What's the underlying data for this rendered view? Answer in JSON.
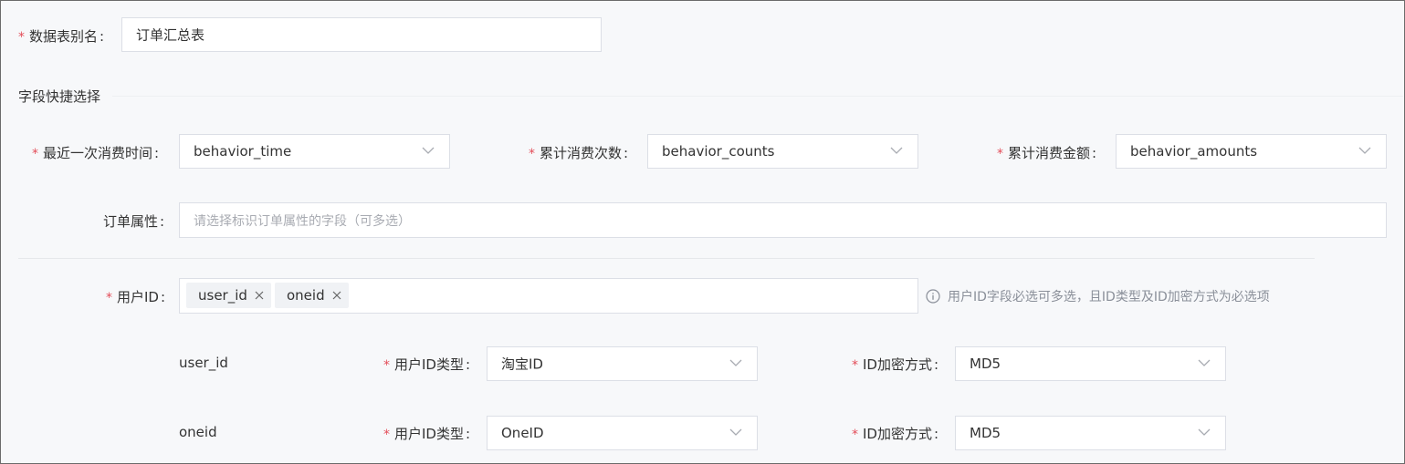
{
  "required_mark": "*",
  "colon": ":",
  "table_alias": {
    "label": "数据表别名",
    "value": "订单汇总表"
  },
  "section_title": "字段快捷选择",
  "row1": {
    "last_time": {
      "label": "最近一次消费时间",
      "value": "behavior_time"
    },
    "counts": {
      "label": "累计消费次数",
      "value": "behavior_counts"
    },
    "amounts": {
      "label": "累计消费金额",
      "value": "behavior_amounts"
    }
  },
  "order_attr": {
    "label": "订单属性",
    "placeholder": "请选择标识订单属性的字段（可多选）"
  },
  "user_id": {
    "label": "用户ID",
    "tags": [
      "user_id",
      "oneid"
    ],
    "hint": "用户ID字段必选可多选，且ID类型及ID加密方式为必选项"
  },
  "id_rows": [
    {
      "name": "user_id",
      "type_label": "用户ID类型",
      "type_value": "淘宝ID",
      "enc_label": "ID加密方式",
      "enc_value": "MD5"
    },
    {
      "name": "oneid",
      "type_label": "用户ID类型",
      "type_value": "OneID",
      "enc_label": "ID加密方式",
      "enc_value": "MD5"
    }
  ]
}
